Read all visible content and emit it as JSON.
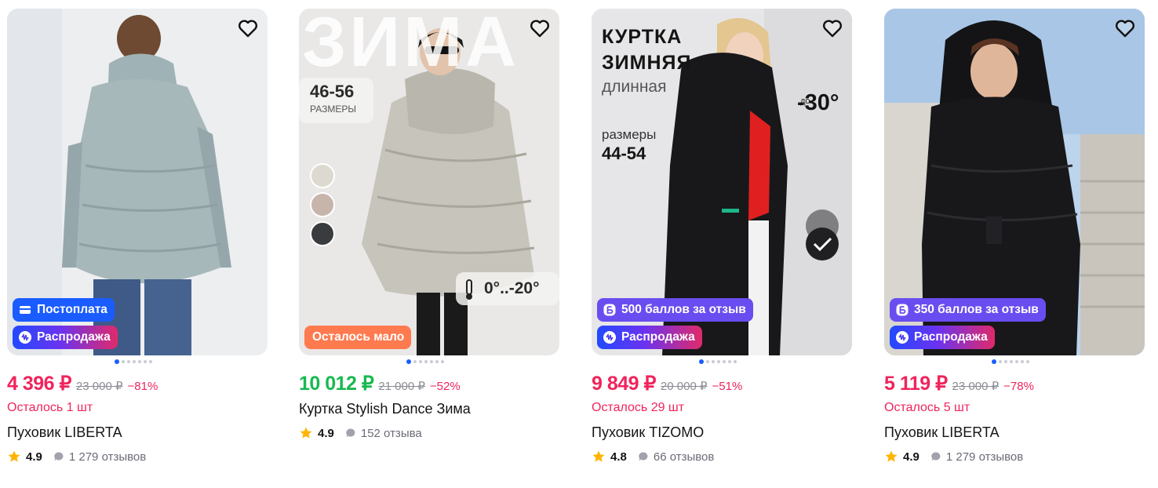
{
  "products": [
    {
      "price": "4 396 ₽",
      "old_price": "23 000 ₽",
      "discount": "−81%",
      "stock": "Осталось 1 шт",
      "name": "Пуховик LIBERTA",
      "rating": "4.9",
      "reviews": "1 279 отзывов",
      "badges": [
        "Постоплата",
        "Распродажа"
      ],
      "price_color": "#f0245c",
      "photo_overlay": {}
    },
    {
      "price": "10 012 ₽",
      "old_price": "21 000 ₽",
      "discount": "−52%",
      "stock": "",
      "name": "Куртка Stylish Dance Зима",
      "rating": "4.9",
      "reviews": "152 отзыва",
      "badges": [
        "Осталось мало"
      ],
      "price_color": "#18b950",
      "photo_overlay": {
        "headline": "ЗИМА",
        "sizes": "46-56",
        "sizes_label": "РАЗМЕРЫ",
        "temperature": "0°..-20°"
      }
    },
    {
      "price": "9 849 ₽",
      "old_price": "20 000 ₽",
      "discount": "−51%",
      "stock": "Осталось 29 шт",
      "name": "Пуховик TIZOMO",
      "rating": "4.8",
      "reviews": "66 отзывов",
      "badges": [
        "500 баллов за отзыв",
        "Распродажа"
      ],
      "price_color": "#f0245c",
      "photo_overlay": {
        "line1": "КУРТКА",
        "line2": "ЗИМНЯЯ",
        "line3": "длинная",
        "sizes_label": "размеры",
        "sizes": "44-54",
        "temp_prefix": "до",
        "temperature": "-30°"
      }
    },
    {
      "price": "5 119 ₽",
      "old_price": "23 000 ₽",
      "discount": "−78%",
      "stock": "Осталось 5 шт",
      "name": "Пуховик LIBERTA",
      "rating": "4.9",
      "reviews": "1 279 отзывов",
      "badges": [
        "350 баллов за отзыв",
        "Распродажа"
      ],
      "price_color": "#f0245c",
      "photo_overlay": {}
    }
  ],
  "icons": {
    "favorite": "heart-outline-icon",
    "rating": "star-icon",
    "reviews": "chat-bubble-icon",
    "postpay": "card-icon",
    "sale": "sale-tag-icon",
    "points": "points-coin-icon"
  },
  "colors": {
    "accent_blue": "#1a5cff",
    "sale_red": "#f0245c",
    "price_green": "#18b950",
    "low_stock_orange": "#ff7a4f",
    "points_purple": "#6a4df0",
    "rating_star": "#ffb400"
  }
}
